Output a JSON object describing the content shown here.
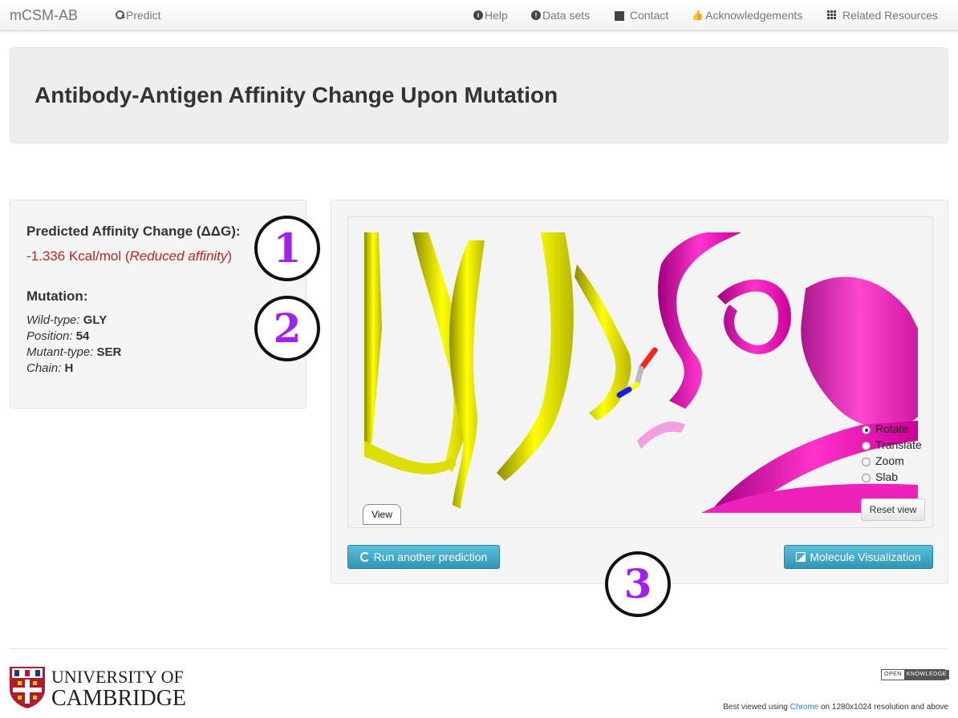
{
  "navbar": {
    "brand": "mCSM-AB",
    "predict": "Predict",
    "help": "Help",
    "datasets": "Data sets",
    "contact": "Contact",
    "acknowledgements": "Acknowledgements",
    "related": "Related Resources"
  },
  "hero": {
    "title": "Antibody-Antigen Affinity Change Upon Mutation"
  },
  "results": {
    "affinity_heading": "Predicted Affinity Change (ΔΔG):",
    "affinity_value": "-1.336 Kcal/mol (",
    "affinity_effect": "Reduced affinity",
    "affinity_close": ")",
    "mutation_heading": "Mutation:",
    "wildtype_label": "Wild-type:",
    "wildtype_value": "GLY",
    "position_label": "Position:",
    "position_value": "54",
    "mutant_label": "Mutant-type:",
    "mutant_value": "SER",
    "chain_label": "Chain:",
    "chain_value": "H"
  },
  "annotations": {
    "one": "1",
    "two": "2",
    "three": "3"
  },
  "viewer": {
    "view_tab": "View",
    "reset_button": "Reset view",
    "modes": [
      {
        "label": "Rotate",
        "selected": true
      },
      {
        "label": "Translate",
        "selected": false
      },
      {
        "label": "Zoom",
        "selected": false
      },
      {
        "label": "Slab",
        "selected": false
      }
    ],
    "colors": {
      "antibody": "#ffff00",
      "antigen": "#ff00cc",
      "oxygen": "#ff2020",
      "nitrogen": "#1a1aff"
    }
  },
  "actions": {
    "run_another": "Run another prediction",
    "molecule_viz": "Molecule Visualization"
  },
  "footer": {
    "university_line1": "UNIVERSITY OF",
    "university_line2": "CAMBRIDGE",
    "okf_open": "OPEN",
    "okf_knowledge": "KNOWLEDGE",
    "best_pre": "Best viewed using ",
    "best_link": "Chrome",
    "best_post": " on 1280x1024 resolution and above"
  }
}
